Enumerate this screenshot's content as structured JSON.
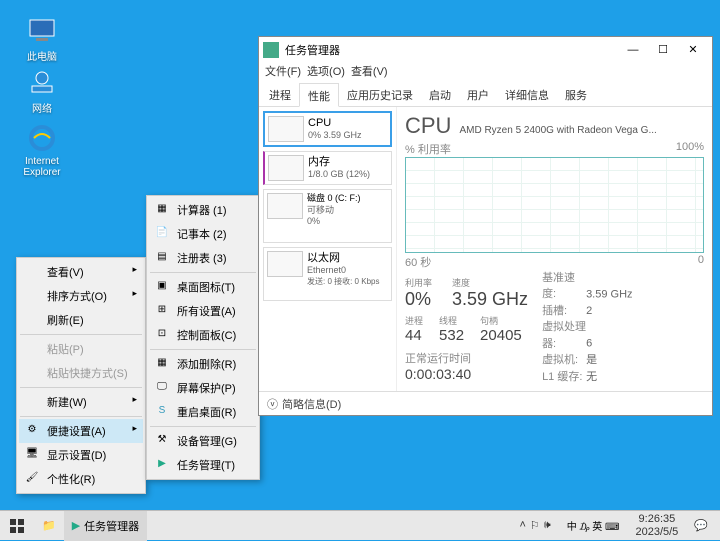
{
  "desktop": {
    "icons": [
      {
        "label": "此电脑"
      },
      {
        "label": "网络"
      },
      {
        "label": "Internet Explorer"
      }
    ]
  },
  "ctx_main": {
    "items": [
      {
        "label": "查看(V)",
        "arrow": true
      },
      {
        "label": "排序方式(O)",
        "arrow": true
      },
      {
        "label": "刷新(E)"
      },
      {
        "sep": true
      },
      {
        "label": "粘贴(P)",
        "dim": true
      },
      {
        "label": "粘贴快捷方式(S)",
        "dim": true
      },
      {
        "sep": true
      },
      {
        "label": "新建(W)",
        "arrow": true
      },
      {
        "sep": true
      },
      {
        "label": "便捷设置(A)",
        "arrow": true,
        "hl": true,
        "icon": "⚙"
      },
      {
        "label": "显示设置(D)",
        "icon": "🖥"
      },
      {
        "label": "个性化(R)",
        "icon": "🎨"
      }
    ]
  },
  "ctx_sub": {
    "items": [
      {
        "label": "计算器  (1)",
        "icon": "▦"
      },
      {
        "label": "记事本  (2)",
        "icon": "📄"
      },
      {
        "label": "注册表  (3)",
        "icon": "▤"
      },
      {
        "sep": true
      },
      {
        "label": "桌面图标(T)",
        "icon": "▣"
      },
      {
        "label": "所有设置(A)",
        "icon": "⊞"
      },
      {
        "label": "控制面板(C)",
        "icon": "⊡"
      },
      {
        "sep": true
      },
      {
        "label": "添加删除(R)",
        "icon": "▦"
      },
      {
        "label": "屏幕保护(P)",
        "icon": "🖵"
      },
      {
        "label": "重启桌面(R)",
        "icon": "S"
      },
      {
        "sep": true
      },
      {
        "label": "设备管理(G)",
        "icon": "⚒"
      },
      {
        "label": "任务管理(T)",
        "icon": "▶"
      }
    ]
  },
  "tm": {
    "title": "任务管理器",
    "menu": [
      "文件(F)",
      "选项(O)",
      "查看(V)"
    ],
    "tabs": [
      "进程",
      "性能",
      "应用历史记录",
      "启动",
      "用户",
      "详细信息",
      "服务"
    ],
    "left": [
      {
        "h": "CPU",
        "s": "0% 3.59 GHz",
        "sel": true
      },
      {
        "h": "内存",
        "s": "1/8.0 GB (12%)",
        "mem": true
      },
      {
        "h": "磁盘 0 (C: F:)",
        "s": "可移动",
        "s2": "0%"
      },
      {
        "h": "以太网",
        "s": "Ethernet0",
        "s2": "发送: 0 接收: 0 Kbps"
      }
    ],
    "cpu_label": "CPU",
    "cpu_model": "AMD Ryzen 5 2400G with Radeon Vega G...",
    "axis_l": "% 利用率",
    "axis_r": "100%",
    "axis_bl": "60 秒",
    "axis_br": "0",
    "stats": {
      "util_lab": "利用率",
      "util": "0%",
      "speed_lab": "速度",
      "speed": "3.59 GHz",
      "proc_lab": "进程",
      "proc": "44",
      "thr_lab": "线程",
      "thr": "532",
      "hnd_lab": "句柄",
      "hnd": "20405"
    },
    "specs": [
      {
        "k": "基准速度:",
        "v": "3.59 GHz"
      },
      {
        "k": "插槽:",
        "v": "2"
      },
      {
        "k": "虚拟处理器:",
        "v": "6"
      },
      {
        "k": "虚拟机:",
        "v": "是"
      },
      {
        "k": "L1 缓存:",
        "v": "无"
      }
    ],
    "uptime_lab": "正常运行时间",
    "uptime": "0:00:03:40",
    "footer": "简略信息(D)"
  },
  "taskbar": {
    "app": "任务管理器",
    "ime": "中 ₯ 英 ⌨",
    "time": "9:26:35",
    "date": "2023/5/5"
  }
}
